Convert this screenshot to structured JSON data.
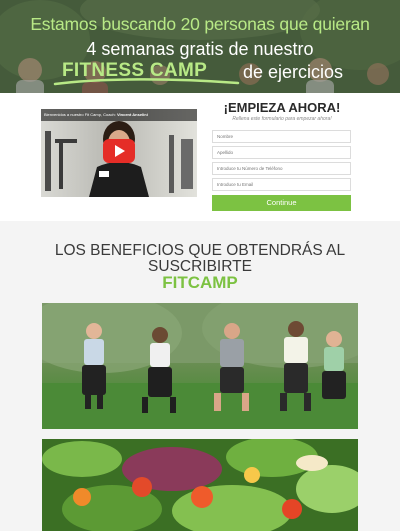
{
  "hero": {
    "line1": "Estamos buscando 20 personas que quieran",
    "line2": "4 semanas gratis de nuestro",
    "highlight": "FITNESS CAMP",
    "line3_end": "de ejercicios"
  },
  "video": {
    "caption_prefix": "Bienvenidos a nuestro Fit Camp, Coach:",
    "caption_name": "Vincent Anselini",
    "play_icon": "youtube-play-icon"
  },
  "form": {
    "title": "¡EMPIEZA AHORA!",
    "subtitle": "Rellena este formulario para empezar ahora!",
    "fields": {
      "nombre": "Nombre",
      "apellido": "Apellido",
      "telefono": "Introduce tu Número de Teléfono",
      "email": "Introduce tu Email"
    },
    "submit_label": "Continue"
  },
  "benefits": {
    "title": "LOS BENEFICIOS QUE OBTENDRÁS AL SUSCRIBIRTE",
    "brand": "FITCAMP"
  },
  "colors": {
    "accent_green": "#7cc242",
    "hero_green_text": "#b8e986",
    "youtube_red": "#e52d27"
  }
}
